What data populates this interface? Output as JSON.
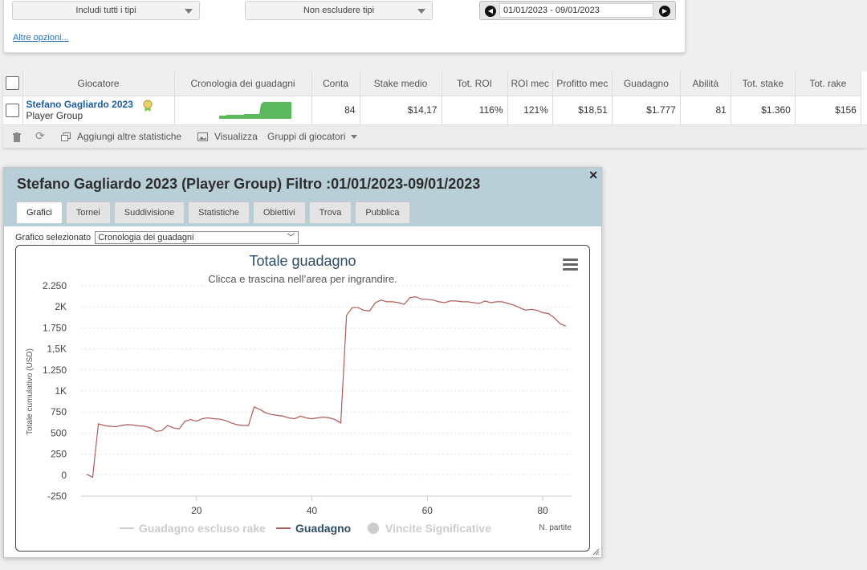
{
  "filters": {
    "include_types": "Includi tutti i tipi",
    "exclude_types": "Non escludere tipi",
    "date_range": "01/01/2023 - 09/01/2023",
    "more_options": "Altre opzioni..."
  },
  "table": {
    "headers": [
      "Giocatore",
      "Cronologia dei guadagni",
      "Conta",
      "Stake medio",
      "Tot. ROI",
      "ROI mec",
      "Profitto mec",
      "Guadagno",
      "Abilità",
      "Tot. stake",
      "Tot. rake"
    ],
    "row": {
      "player_name": "Stefano Gagliardo 2023",
      "player_group": "Player Group",
      "values": [
        "84",
        "$14,17",
        "116%",
        "121%",
        "$18,51",
        "$1.777",
        "81",
        "$1.360",
        "$156"
      ]
    },
    "toolbar": {
      "add_stats": "Aggiungi altre statistiche",
      "view": "Visualizza",
      "player_groups": "Gruppi di giocatori"
    }
  },
  "dialog": {
    "title": "Stefano Gagliardo 2023 (Player Group) Filtro :01/01/2023-09/01/2023",
    "tabs": [
      "Grafici",
      "Tornei",
      "Suddivisione",
      "Statistiche",
      "Obiettivi",
      "Trova",
      "Pubblica"
    ],
    "chart_select_label": "Grafico selezionato",
    "chart_select_value": "Cronologia dei guadagni"
  },
  "colors": {
    "dialog_header": "#b9cfd8",
    "series_line": "#b05a5a",
    "sparkline": "#5cb85c",
    "title_blue": "#2d4d66"
  },
  "chart_data": {
    "type": "line",
    "title": "Totale guadagno",
    "subtitle": "Clicca e trascina nell’area per ingrandire.",
    "xlabel": "N. partite",
    "ylabel": "Totale cumulativo (USD)",
    "xlim": [
      0,
      85
    ],
    "ylim": [
      -250,
      2250
    ],
    "x_ticks": [
      "20",
      "40",
      "60",
      "80"
    ],
    "x_tick_values": [
      20,
      40,
      60,
      80
    ],
    "y_ticks": [
      "-250",
      "0",
      "250",
      "500",
      "750",
      "1K",
      "1.250",
      "1,5K",
      "1.750",
      "2K",
      "2.250"
    ],
    "y_tick_values": [
      -250,
      0,
      250,
      500,
      750,
      1000,
      1250,
      1500,
      1750,
      2000,
      2250
    ],
    "grid": true,
    "legend": [
      "Guadagno escluso rake",
      "Guadagno",
      "Vincite Significative"
    ],
    "legend_active": "Guadagno",
    "series": [
      {
        "name": "Guadagno",
        "x": [
          1,
          2,
          3,
          4,
          5,
          6,
          7,
          8,
          9,
          10,
          11,
          12,
          13,
          14,
          15,
          16,
          17,
          18,
          19,
          20,
          21,
          22,
          23,
          24,
          25,
          26,
          27,
          28,
          29,
          30,
          31,
          32,
          33,
          34,
          35,
          36,
          37,
          38,
          39,
          40,
          41,
          42,
          43,
          44,
          45,
          46,
          47,
          48,
          49,
          50,
          51,
          52,
          53,
          54,
          55,
          56,
          57,
          58,
          59,
          60,
          61,
          62,
          63,
          64,
          65,
          66,
          67,
          68,
          69,
          70,
          71,
          72,
          73,
          74,
          75,
          76,
          77,
          78,
          79,
          80,
          81,
          82,
          83,
          84
        ],
        "values": [
          10,
          -25,
          610,
          590,
          580,
          575,
          590,
          600,
          595,
          585,
          580,
          560,
          520,
          530,
          590,
          560,
          550,
          640,
          660,
          640,
          670,
          680,
          670,
          665,
          650,
          620,
          600,
          590,
          590,
          810,
          780,
          740,
          720,
          710,
          700,
          680,
          670,
          700,
          680,
          670,
          680,
          690,
          680,
          660,
          620,
          1900,
          1990,
          1990,
          1960,
          1950,
          2050,
          2080,
          2060,
          2060,
          2050,
          2030,
          2110,
          2120,
          2090,
          2090,
          2080,
          2060,
          2050,
          2070,
          2070,
          2060,
          2060,
          2050,
          2040,
          2070,
          2050,
          2060,
          2060,
          2040,
          2020,
          1990,
          1960,
          1970,
          1960,
          1930,
          1920,
          1870,
          1800,
          1770
        ]
      }
    ]
  }
}
